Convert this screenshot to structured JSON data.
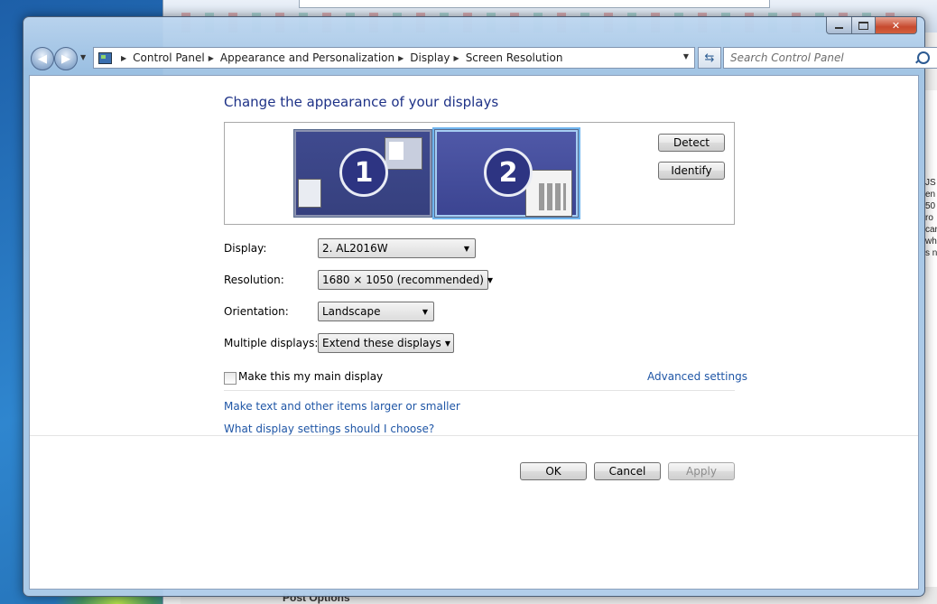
{
  "background": {
    "post_options": "Post Options",
    "right_strip_text": "JS\nen\n50\nro\ncar\nwh\ns n"
  },
  "address_bar": {
    "crumbs": [
      "Control Panel",
      "Appearance and Personalization",
      "Display",
      "Screen Resolution"
    ]
  },
  "search": {
    "placeholder": "Search Control Panel"
  },
  "main": {
    "title": "Change the appearance of your displays",
    "monitors": [
      "1",
      "2"
    ],
    "detect_label": "Detect",
    "identify_label": "Identify",
    "fields": {
      "display": {
        "label": "Display:",
        "value": "2. AL2016W"
      },
      "resolution": {
        "label": "Resolution:",
        "value": "1680 × 1050 (recommended)"
      },
      "orientation": {
        "label": "Orientation:",
        "value": "Landscape"
      },
      "multiple": {
        "label": "Multiple displays:",
        "value": "Extend these displays"
      }
    },
    "main_display_label": "Make this my main display",
    "main_display_checked": false,
    "advanced_settings": "Advanced settings",
    "link_text_size": "Make text and other items larger or smaller",
    "link_help": "What display settings should I choose?",
    "ok_label": "OK",
    "cancel_label": "Cancel",
    "apply_label": "Apply"
  }
}
